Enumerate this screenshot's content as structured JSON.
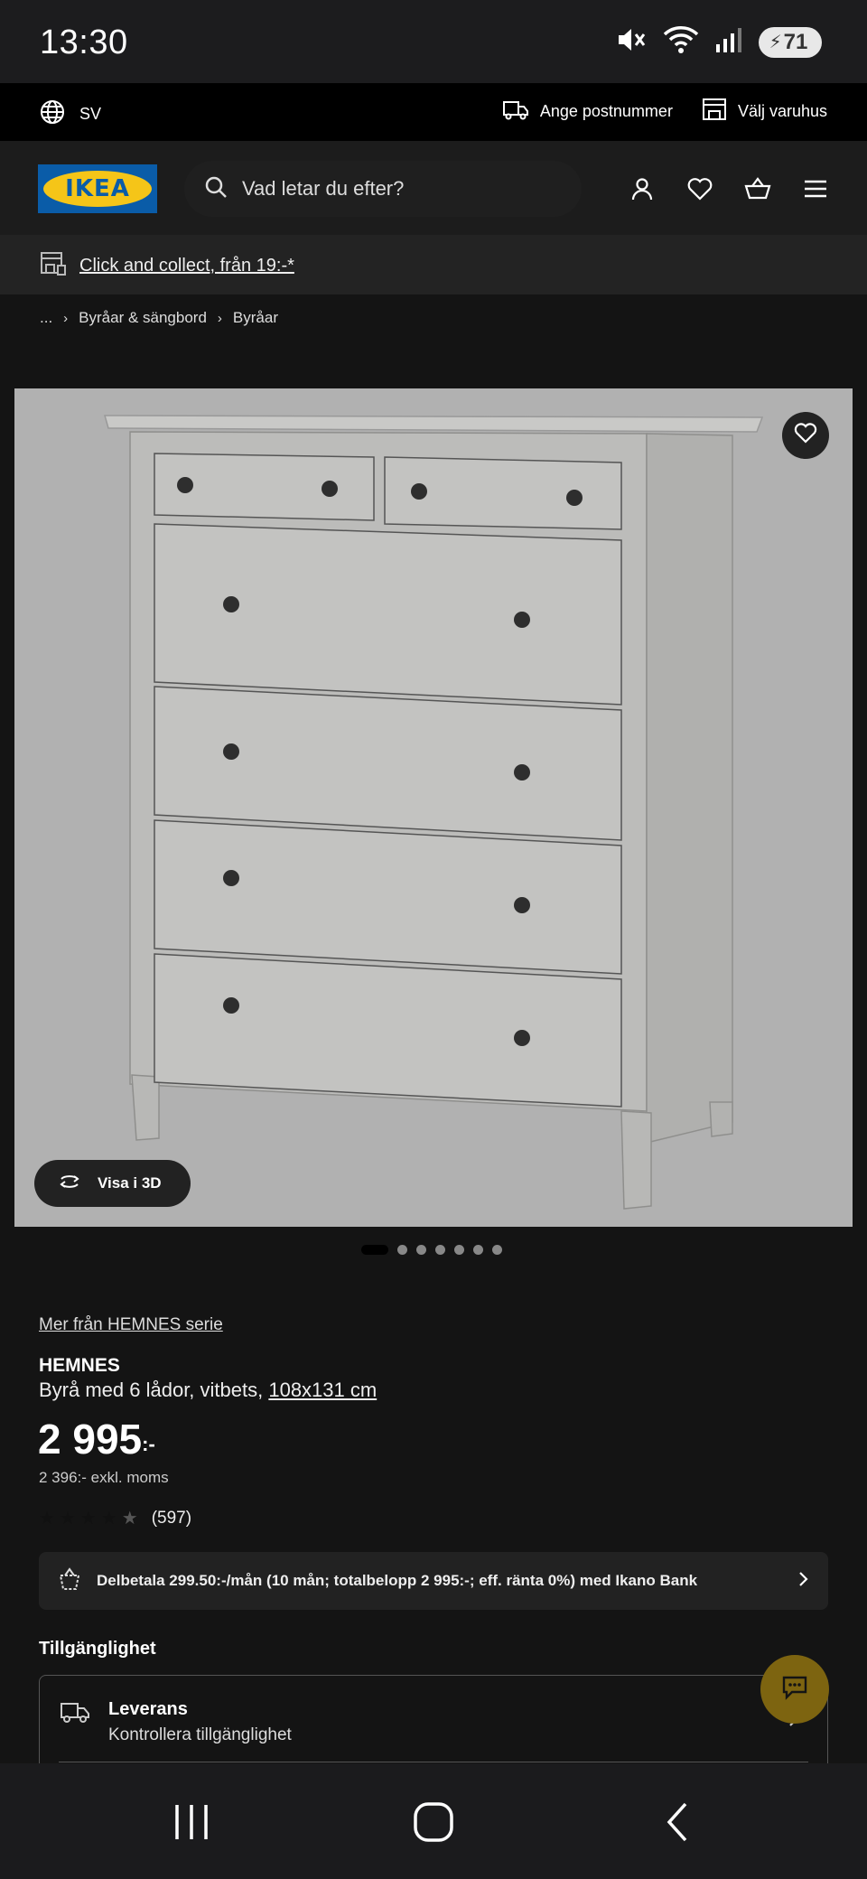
{
  "status_bar": {
    "time": "13:30",
    "battery": "71"
  },
  "utility": {
    "language": "SV",
    "postcode": "Ange postnummer",
    "store": "Välj varuhus"
  },
  "header": {
    "logo": "IKEA",
    "search_placeholder": "Vad letar du efter?"
  },
  "click_collect": {
    "text": "Click and collect, från 19:-*"
  },
  "breadcrumb": {
    "root": "...",
    "items": [
      "Byråar & sängbord",
      "Byråar"
    ]
  },
  "gallery": {
    "view_3d_label": "Visa i 3D",
    "image_count": 7,
    "active_index": 0
  },
  "product": {
    "series_link": "Mer från HEMNES serie",
    "name": "HEMNES",
    "description": "Byrå med 6 lådor, vitbets, ",
    "size_link": "108x131 cm",
    "price": "2 995",
    "price_suffix": ":-",
    "price_excl": "2 396:- exkl. moms",
    "rating": 4.5,
    "review_count": "(597)"
  },
  "financing": {
    "text": "Delbetala 299.50:-/mån (10 mån; totalbelopp 2 995:-; eff. ränta 0%) med Ikano Bank"
  },
  "availability": {
    "title": "Tillgänglighet",
    "delivery_title": "Leverans",
    "delivery_sub": "Kontrollera tillgänglighet"
  },
  "colors": {
    "accent_gold": "#7d6410",
    "logo_blue": "#0a5ca8",
    "logo_yellow": "#f5c518"
  }
}
